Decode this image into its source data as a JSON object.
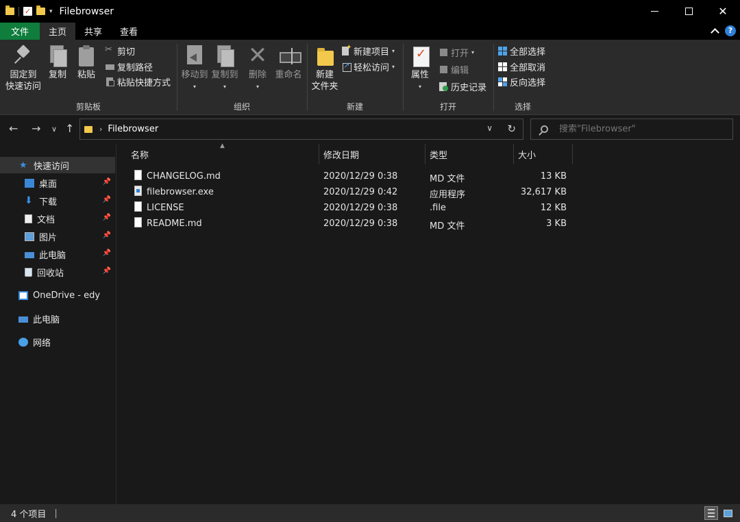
{
  "window": {
    "title": "Filebrowser"
  },
  "tabs": {
    "file": "文件",
    "home": "主页",
    "share": "共享",
    "view": "查看"
  },
  "ribbon": {
    "clipboard": {
      "pin_line1": "固定到",
      "pin_line2": "快速访问",
      "copy": "复制",
      "paste": "粘贴",
      "cut": "剪切",
      "copy_path": "复制路径",
      "paste_shortcut": "粘贴快捷方式",
      "label": "剪贴板"
    },
    "organize": {
      "move_to": "移动到",
      "copy_to": "复制到",
      "delete": "删除",
      "rename": "重命名",
      "label": "组织"
    },
    "new": {
      "new_folder_line1": "新建",
      "new_folder_line2": "文件夹",
      "new_item": "新建项目",
      "easy_access": "轻松访问",
      "label": "新建"
    },
    "open": {
      "properties": "属性",
      "open": "打开",
      "edit": "编辑",
      "history": "历史记录",
      "label": "打开"
    },
    "select": {
      "select_all": "全部选择",
      "select_none": "全部取消",
      "invert": "反向选择",
      "label": "选择"
    }
  },
  "address": {
    "path": "Filebrowser",
    "search_placeholder": "搜索\"Filebrowser\""
  },
  "nav_pane": {
    "quick_access": "快速访问",
    "desktop": "桌面",
    "downloads": "下载",
    "documents": "文档",
    "pictures": "图片",
    "this_pc_pinned": "此电脑",
    "recycle_bin": "回收站",
    "onedrive": "OneDrive - edy",
    "this_pc": "此电脑",
    "network": "网络"
  },
  "columns": {
    "name": "名称",
    "modified": "修改日期",
    "type": "类型",
    "size": "大小"
  },
  "files": [
    {
      "name": "CHANGELOG.md",
      "modified": "2020/12/29 0:38",
      "type": "MD 文件",
      "size": "13 KB"
    },
    {
      "name": "filebrowser.exe",
      "modified": "2020/12/29 0:42",
      "type": "应用程序",
      "size": "32,617 KB"
    },
    {
      "name": "LICENSE",
      "modified": "2020/12/29 0:38",
      "type": ".file",
      "size": "12 KB"
    },
    {
      "name": "README.md",
      "modified": "2020/12/29 0:38",
      "type": "MD 文件",
      "size": "3 KB"
    }
  ],
  "status": {
    "count": "4 个项目"
  }
}
